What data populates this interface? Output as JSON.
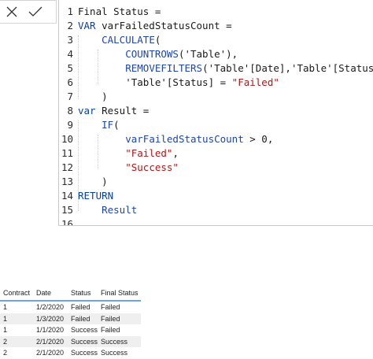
{
  "formula_bar": {
    "cancel_icon": "close-icon",
    "commit_icon": "checkmark-icon"
  },
  "editor": {
    "lines": [
      {
        "n": "1",
        "tokens": [
          {
            "t": "Final Status =",
            "c": "txt"
          }
        ]
      },
      {
        "n": "2",
        "tokens": [
          {
            "t": "VAR",
            "c": "kw"
          },
          {
            "t": " varFailedStatusCount =",
            "c": "txt"
          }
        ]
      },
      {
        "n": "3",
        "tokens": [
          {
            "t": "    ",
            "c": "txt"
          },
          {
            "t": "CALCULATE",
            "c": "fn"
          },
          {
            "t": "(",
            "c": "txt"
          }
        ]
      },
      {
        "n": "4",
        "tokens": [
          {
            "t": "        ",
            "c": "txt"
          },
          {
            "t": "COUNTROWS",
            "c": "fn"
          },
          {
            "t": "('Table'),",
            "c": "txt"
          }
        ]
      },
      {
        "n": "5",
        "tokens": [
          {
            "t": "        ",
            "c": "txt"
          },
          {
            "t": "REMOVEFILTERS",
            "c": "fn"
          },
          {
            "t": "('Table'[Date],'Table'[Status]),",
            "c": "txt"
          }
        ]
      },
      {
        "n": "6",
        "tokens": [
          {
            "t": "        'Table'[Status] = ",
            "c": "txt"
          },
          {
            "t": "\"Failed\"",
            "c": "str"
          }
        ]
      },
      {
        "n": "7",
        "tokens": [
          {
            "t": "    )",
            "c": "txt"
          }
        ]
      },
      {
        "n": "8",
        "tokens": [
          {
            "t": "var",
            "c": "kw"
          },
          {
            "t": " Result =",
            "c": "txt"
          }
        ]
      },
      {
        "n": "9",
        "tokens": [
          {
            "t": "    ",
            "c": "txt"
          },
          {
            "t": "IF",
            "c": "fn"
          },
          {
            "t": "(",
            "c": "txt"
          }
        ]
      },
      {
        "n": "10",
        "tokens": [
          {
            "t": "        ",
            "c": "txt"
          },
          {
            "t": "varFailedStatusCount",
            "c": "var"
          },
          {
            "t": " > 0,",
            "c": "txt"
          }
        ]
      },
      {
        "n": "11",
        "tokens": [
          {
            "t": "        ",
            "c": "txt"
          },
          {
            "t": "\"Failed\"",
            "c": "str"
          },
          {
            "t": ",",
            "c": "txt"
          }
        ]
      },
      {
        "n": "12",
        "tokens": [
          {
            "t": "        ",
            "c": "txt"
          },
          {
            "t": "\"Success\"",
            "c": "str"
          }
        ]
      },
      {
        "n": "13",
        "tokens": [
          {
            "t": "    )",
            "c": "txt"
          }
        ]
      },
      {
        "n": "14",
        "tokens": [
          {
            "t": "RETURN",
            "c": "kw"
          }
        ]
      },
      {
        "n": "15",
        "tokens": [
          {
            "t": "    ",
            "c": "txt"
          },
          {
            "t": "Result",
            "c": "var"
          }
        ]
      },
      {
        "n": "16",
        "tokens": []
      }
    ]
  },
  "table": {
    "headers": [
      "Contract",
      "Date",
      "Status",
      "Final Status"
    ],
    "rows": [
      [
        "1",
        "1/2/2020",
        "Failed",
        "Failed"
      ],
      [
        "1",
        "1/3/2020",
        "Failed",
        "Failed"
      ],
      [
        "1",
        "1/1/2020",
        "Success",
        "Failed"
      ],
      [
        "2",
        "2/1/2020",
        "Success",
        "Success"
      ],
      [
        "2",
        "2/1/2020",
        "Success",
        "Success"
      ]
    ]
  }
}
